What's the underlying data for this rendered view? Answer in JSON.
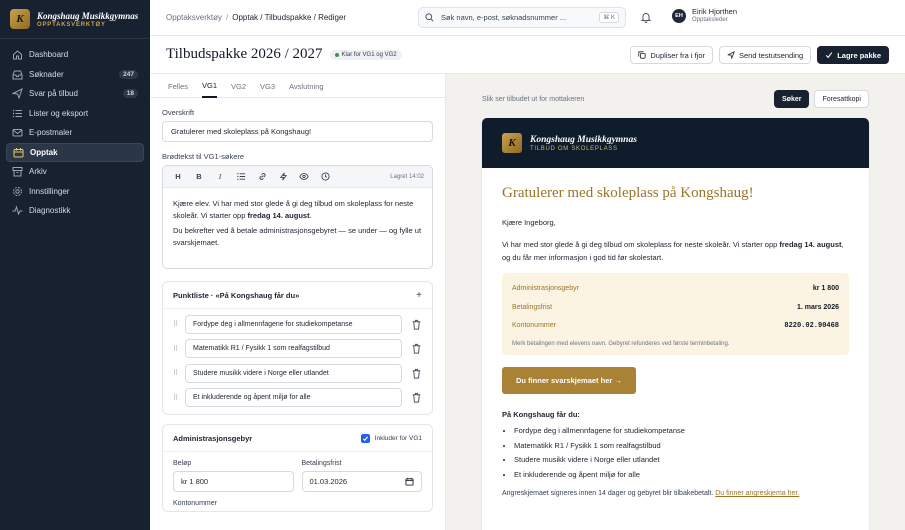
{
  "brand": {
    "name": "Kongshaug Musikkgymnas",
    "sub": "OPPTAKSVERKTØY",
    "logo_letter": "K"
  },
  "sidebar": {
    "items": [
      {
        "label": "Dashboard",
        "icon": "home-icon",
        "badge": ""
      },
      {
        "label": "Søknader",
        "icon": "inbox-icon",
        "badge": "247"
      },
      {
        "label": "Svar på tilbud",
        "icon": "send-icon",
        "badge": "18"
      },
      {
        "label": "Lister og eksport",
        "icon": "list-icon",
        "badge": ""
      },
      {
        "label": "E-postmaler",
        "icon": "mail-icon",
        "badge": ""
      },
      {
        "label": "Opptak",
        "icon": "calendar-icon",
        "badge": "",
        "active": true
      },
      {
        "label": "Arkiv",
        "icon": "archive-icon",
        "badge": ""
      },
      {
        "label": "Innstillinger",
        "icon": "gear-icon",
        "badge": ""
      },
      {
        "label": "Diagnostikk",
        "icon": "pulse-icon",
        "badge": ""
      }
    ]
  },
  "topbar": {
    "crumb1": "Opptaksverktøy",
    "crumb2": "Opptak / Tilbudspakke / Rediger",
    "search_placeholder": "Søk navn, e-post, søknadsnummer ...",
    "search_kbd": "⌘ K",
    "user_initials": "EH",
    "user_name": "Eirik Hjorthen",
    "user_role": "Opptaksleder"
  },
  "page": {
    "title": "Tilbudspakke 2026 / 2027",
    "status": "Klar for VG1 og VG2",
    "btn_duplicate": "Dupliser fra i fjor",
    "btn_test": "Send testutsending",
    "btn_save": "Lagre pakke"
  },
  "tabs": [
    "Felles",
    "VG1",
    "VG2",
    "VG3",
    "Avslutning"
  ],
  "editor": {
    "heading_label": "Overskrift",
    "heading_value": "Gratulerer med skoleplass på Kongshaug!",
    "body_label": "Brødtekst til VG1-søkere",
    "saved": "Lagret 14:02",
    "p1_a": "Kjære elev. Vi har med stor glede å gi deg tilbud om skoleplass for neste skoleår. Vi starter opp ",
    "p1_b": "fredag 14. august",
    "p1_c": ".",
    "p2": "Du bekrefter ved å betale administrasjonsgebyret — se under — og fylle ut svarskjemaet."
  },
  "bullets": {
    "title": "Punktliste · «På Kongshaug får du»",
    "items": [
      "Fordype deg i allmennfagene for studiekompetanse",
      "Matematikk R1 / Fysikk 1 som realfagstilbud",
      "Studere musikk videre i Norge eller utlandet",
      "Et inkluderende og åpent miljø for alle"
    ]
  },
  "fee": {
    "title": "Administrasjonsgebyr",
    "include_label": "Inkluder for VG1",
    "amount_label": "Beløp",
    "amount_value": "kr 1 800",
    "due_label": "Betalingsfrist",
    "due_value": "01.03.2026",
    "account_label": "Kontonummer"
  },
  "preview": {
    "note": "Slik ser tilbudet ut for mottakeren",
    "toggle_applicant": "Søker",
    "toggle_guardian": "Foresattkopi",
    "mail_brand": "Kongshaug Musikkgymnas",
    "mail_sub": "TILBUD OM SKOLEPLASS",
    "heading": "Gratulerer med skoleplass på Kongshaug!",
    "greeting": "Kjære Ingeborg,",
    "intro_a": "Vi har med stor glede å gi deg tilbud om skoleplass for neste skoleår. Vi starter opp ",
    "intro_b": "fredag 14. august",
    "intro_c": ", og du får mer informasjon i god tid før skolestart.",
    "box": [
      {
        "label": "Administrasjonsgebyr",
        "value": "kr 1 800"
      },
      {
        "label": "Betalingsfrist",
        "value": "1. mars 2026"
      },
      {
        "label": "Kontonummer",
        "value": "8220.02.90468"
      }
    ],
    "box_note": "Merk betalingen med elevens navn. Gebyret refunderes ved første terminbetaling.",
    "cta": "Du finner svarskjemaet her →",
    "list_title": "På Kongshaug får du:",
    "footer_text": "Angreskjemaet signeres innen 14 dager og gebyret blir tilbakebetalt. ",
    "footer_link": "Du finner angreskjema her."
  },
  "colors": {
    "sidebar": "#172130",
    "gold": "#a98236",
    "accent_text": "#9b742a"
  }
}
